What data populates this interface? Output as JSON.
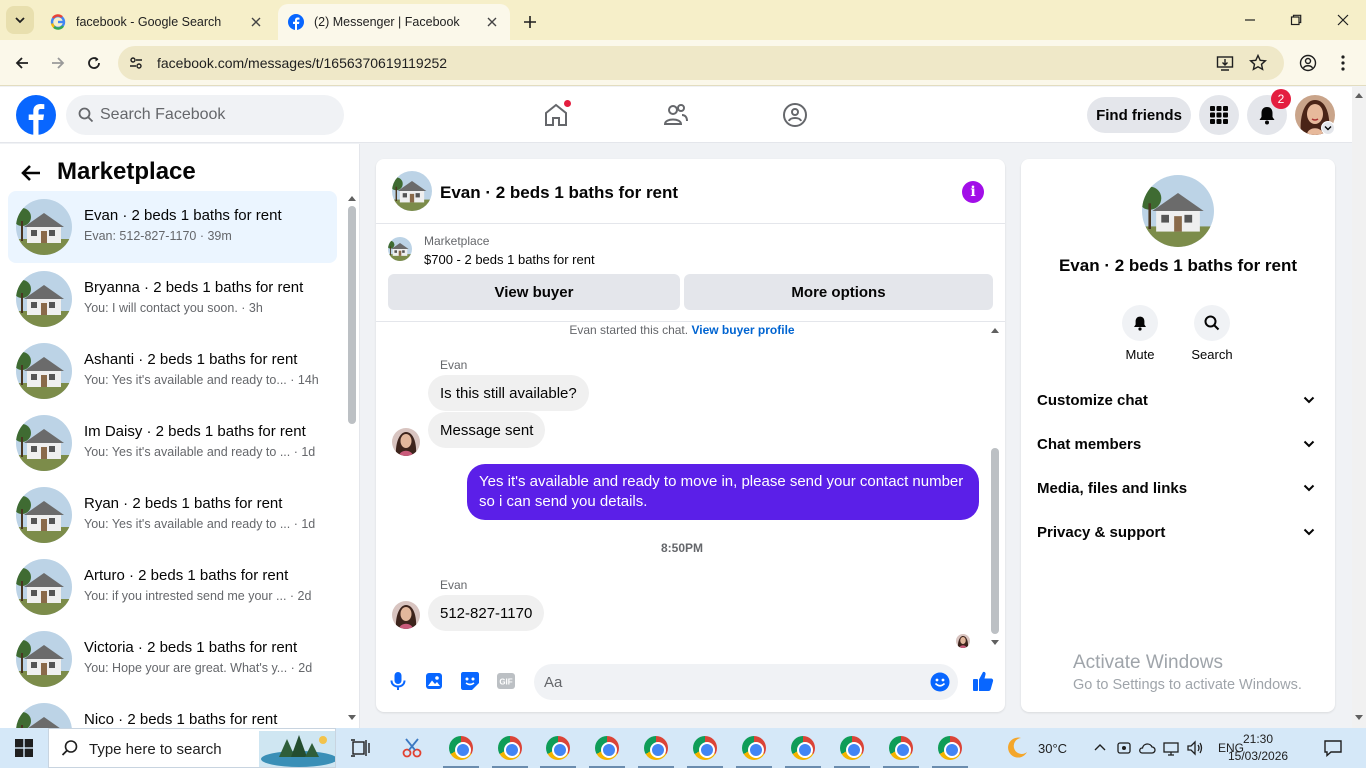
{
  "browser": {
    "tabs": [
      {
        "title": "facebook - Google Search",
        "active": false,
        "favicon": "google-icon"
      },
      {
        "title": "(2) Messenger | Facebook",
        "active": true,
        "favicon": "facebook-icon"
      }
    ],
    "url": "facebook.com/messages/t/1656370619119252"
  },
  "fb_header": {
    "search_placeholder": "Search Facebook",
    "find_friends": "Find friends",
    "notification_count": "2"
  },
  "sidebar": {
    "title": "Marketplace",
    "conversations": [
      {
        "name": "Evan · 2 beds 1 baths for rent",
        "snippet": "Evan: 512-827-1170",
        "time": "39m",
        "selected": true
      },
      {
        "name": "Bryanna · 2 beds 1 baths for rent",
        "snippet": "You: I will contact you soon.",
        "time": "3h"
      },
      {
        "name": "Ashanti · 2 beds 1 baths for rent",
        "snippet": "You: Yes it's available and ready to...",
        "time": "14h"
      },
      {
        "name": "Im Daisy · 2 beds 1 baths for rent",
        "snippet": "You: Yes it's available and ready to ...",
        "time": "1d"
      },
      {
        "name": "Ryan · 2 beds 1 baths for rent",
        "snippet": "You: Yes it's available and ready to ...",
        "time": "1d"
      },
      {
        "name": "Arturo · 2 beds 1 baths for rent",
        "snippet": "You: if you intrested send me your ...",
        "time": "2d"
      },
      {
        "name": "Victoria · 2 beds 1 baths for rent",
        "snippet": "You: Hope your are great. What's y...",
        "time": "2d"
      },
      {
        "name": "Nico · 2 beds 1 baths for rent",
        "snippet": "",
        "time": ""
      }
    ]
  },
  "chat": {
    "title": "Evan · 2 beds 1 baths for rent",
    "marketplace_label": "Marketplace",
    "listing": "$700 - 2 beds 1 baths for rent",
    "view_buyer": "View buyer",
    "more_options": "More options",
    "system_msg": "Evan started this chat.",
    "system_link": "View buyer profile",
    "sender_1": "Evan",
    "msg_1": "Is this still available?",
    "msg_2": "Message sent",
    "msg_out": "Yes it's available and ready to move in, please send your contact number so i can send you details.",
    "timestamp": "8:50PM",
    "sender_2": "Evan",
    "msg_3": "512-827-1170",
    "composer_placeholder": "Aa"
  },
  "right_panel": {
    "name": "Evan · 2 beds 1 baths for rent",
    "mute": "Mute",
    "search": "Search",
    "sections": [
      "Customize chat",
      "Chat members",
      "Media, files and links",
      "Privacy & support"
    ]
  },
  "watermark": {
    "line1": "Activate Windows",
    "line2": "Go to Settings to activate Windows."
  },
  "taskbar": {
    "search_placeholder": "Type here to search",
    "weather": "30°C",
    "lang": "ENG",
    "time": "21:30",
    "date": "15/03/2026"
  },
  "colors": {
    "fb_blue": "#0866ff",
    "messenger_purple": "#5b1fe8",
    "info_purple": "#a20ee8",
    "badge_red": "#e41e3f"
  }
}
